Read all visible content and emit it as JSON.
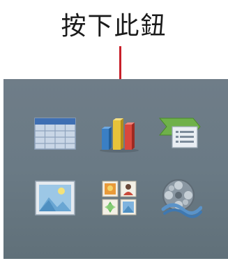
{
  "callout": {
    "text": "按下此鈕"
  },
  "placeholder_icons": [
    {
      "id": "table",
      "icon": "insert-table-icon"
    },
    {
      "id": "chart",
      "icon": "insert-chart-icon"
    },
    {
      "id": "smartart",
      "icon": "insert-smartart-icon"
    },
    {
      "id": "picture",
      "icon": "insert-picture-icon"
    },
    {
      "id": "clipart",
      "icon": "insert-clipart-icon"
    },
    {
      "id": "media",
      "icon": "insert-media-icon"
    }
  ],
  "colors": {
    "callout_line": "#c8202a",
    "panel_bg": "#6c7b86"
  }
}
